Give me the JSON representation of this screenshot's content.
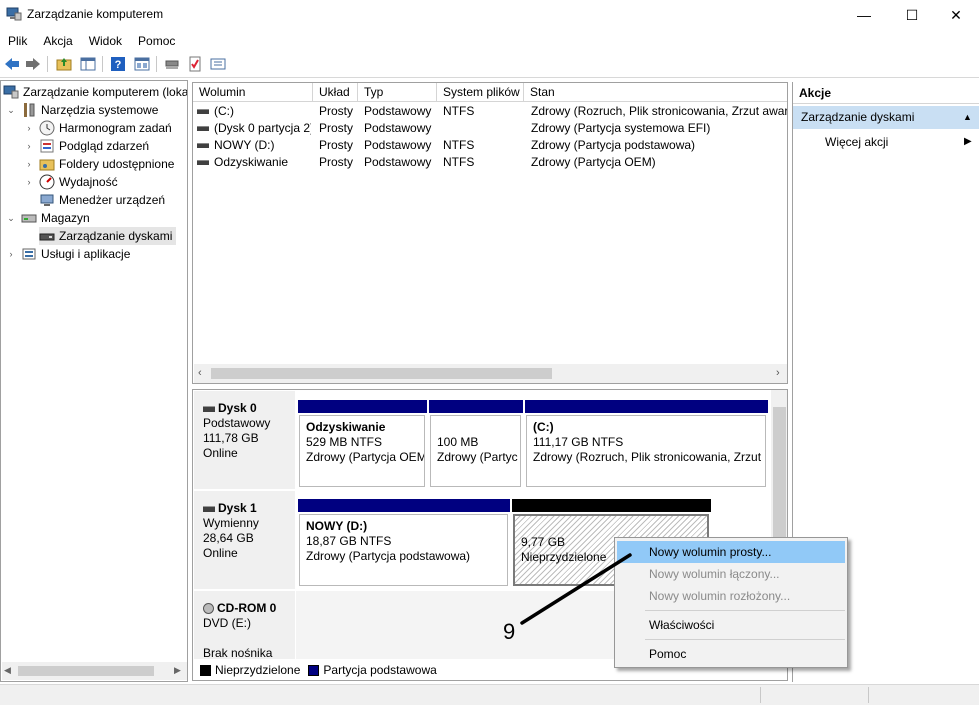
{
  "window": {
    "title": "Zarządzanie komputerem",
    "minimize": "—",
    "maximize": "☐",
    "close": "✕"
  },
  "menu": [
    "Plik",
    "Akcja",
    "Widok",
    "Pomoc"
  ],
  "toolbar_icons": [
    "back-arrow-icon",
    "forward-arrow-icon",
    "up-folder-icon",
    "show-hide-tree-icon",
    "help-icon",
    "details-view-icon",
    "connect-icon",
    "checklist-icon",
    "properties-icon"
  ],
  "tree": {
    "root": "Zarządzanie komputerem (loka",
    "system_tools": "Narzędzia systemowe",
    "task_scheduler": "Harmonogram zadań",
    "event_viewer": "Podgląd zdarzeń",
    "shared_folders": "Foldery udostępnione",
    "performance": "Wydajność",
    "device_manager": "Menedżer urządzeń",
    "storage": "Magazyn",
    "disk_management": "Zarządzanie dyskami",
    "services": "Usługi i aplikacje"
  },
  "volume_table": {
    "headers": [
      "Wolumin",
      "Układ",
      "Typ",
      "System plików",
      "Stan"
    ],
    "rows": [
      [
        "(C:)",
        "Prosty",
        "Podstawowy",
        "NTFS",
        "Zdrowy (Rozruch, Plik stronicowania, Zrzut awar"
      ],
      [
        "(Dysk 0 partycja 2)",
        "Prosty",
        "Podstawowy",
        "",
        "Zdrowy (Partycja systemowa EFI)"
      ],
      [
        "NOWY (D:)",
        "Prosty",
        "Podstawowy",
        "NTFS",
        "Zdrowy (Partycja podstawowa)"
      ],
      [
        "Odzyskiwanie",
        "Prosty",
        "Podstawowy",
        "NTFS",
        "Zdrowy (Partycja OEM)"
      ]
    ]
  },
  "disks": {
    "disk0": {
      "name": "Dysk 0",
      "type": "Podstawowy",
      "size": "111,78 GB",
      "status": "Online",
      "p1": {
        "name": "Odzyskiwanie",
        "size": "529 MB NTFS",
        "status": "Zdrowy (Partycja OEM"
      },
      "p2": {
        "size": "100 MB",
        "status": "Zdrowy (Partyc"
      },
      "p3": {
        "name": "(C:)",
        "size": "111,17 GB NTFS",
        "status": "Zdrowy (Rozruch, Plik stronicowania, Zrzut"
      }
    },
    "disk1": {
      "name": "Dysk 1",
      "type": "Wymienny",
      "size": "28,64 GB",
      "status": "Online",
      "p1": {
        "name": "NOWY  (D:)",
        "size": "18,87 GB NTFS",
        "status": "Zdrowy (Partycja podstawowa)"
      },
      "p2": {
        "size": "9,77 GB",
        "status": "Nieprzydzielone"
      }
    },
    "cdrom": {
      "name": "CD-ROM 0",
      "type": "DVD (E:)",
      "status": "Brak nośnika"
    }
  },
  "legend": {
    "unallocated": "Nieprzydzielone",
    "primary": "Partycja podstawowa"
  },
  "colors": {
    "primary_partition": "#000080",
    "unallocated": "#000000",
    "highlight": "#91c9f7",
    "actions_section": "#c9dff3"
  },
  "actions": {
    "title": "Akcje",
    "section": "Zarządzanie dyskami",
    "more": "Więcej akcji"
  },
  "context_menu": {
    "new_simple": "Nowy wolumin prosty...",
    "new_spanned": "Nowy wolumin łączony...",
    "new_striped": "Nowy wolumin rozłożony...",
    "properties": "Właściwości",
    "help": "Pomoc"
  },
  "annotation": {
    "number": "9"
  }
}
